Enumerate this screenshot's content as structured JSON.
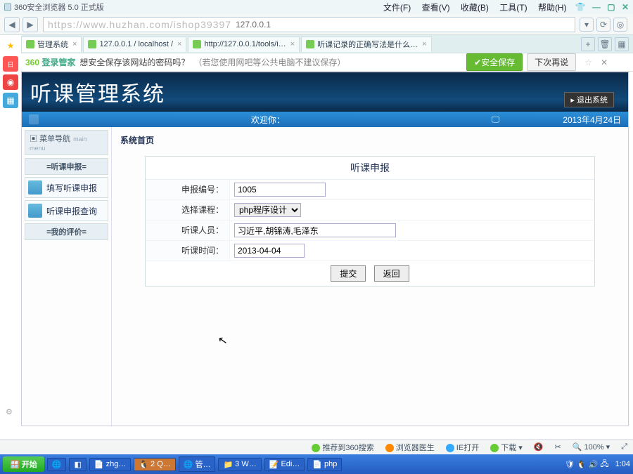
{
  "titlebar": {
    "app": "360安全浏览器 5.0 正式版"
  },
  "menus": {
    "file": "文件(F)",
    "view": "查看(V)",
    "fav": "收藏(B)",
    "tools": "工具(T)",
    "help": "帮助(H)"
  },
  "url": {
    "ghost": "https://www.huzhan.com/ishop39397",
    "ip": "127.0.0.1"
  },
  "tabs": {
    "t1": "管理系统",
    "t2": "127.0.0.1 / localhost / ",
    "t3": "http://127.0.0.1/tools/i…",
    "t4": "听课记录的正确写法是什么…"
  },
  "savebar": {
    "brand": "360",
    "brand2": "登录管家",
    "msg": "想安全保存该网站的密码吗？",
    "msg2": "（若您使用网吧等公共电脑不建议保存）",
    "save": "安全保存",
    "later": "下次再说"
  },
  "app": {
    "title": "听课管理系统",
    "logout": "退出系统",
    "welcome": "欢迎你：",
    "date": "2013年4月24日"
  },
  "nav": {
    "head": "菜单导航",
    "head_en": "main menu",
    "sec1": "=听课申报=",
    "i1": "填写听课申报",
    "i2": "听课申报查询",
    "sec2": "=我的评价="
  },
  "page": {
    "title": "系统首页"
  },
  "form": {
    "head": "听课申报",
    "f1": "申报编号：",
    "v1": "1005",
    "f2": "选择课程：",
    "v2": "php程序设计",
    "f3": "听课人员：",
    "v3": "习近平,胡锦涛,毛泽东",
    "f4": "听课时间：",
    "v4": "2013-04-04",
    "submit": "提交",
    "back": "返回"
  },
  "status": {
    "s1": "推荐到360搜索",
    "s2": "浏览器医生",
    "s3": "IE打开",
    "s4": "下载",
    "s5": "",
    "zoom": "100%"
  },
  "taskbar": {
    "start": "开始",
    "t1": "zhg…",
    "t2": "2 Q…",
    "t3": "管…",
    "t4": "3 W…",
    "t5": "Edi…",
    "t6": "php",
    "clock": "1:04"
  }
}
